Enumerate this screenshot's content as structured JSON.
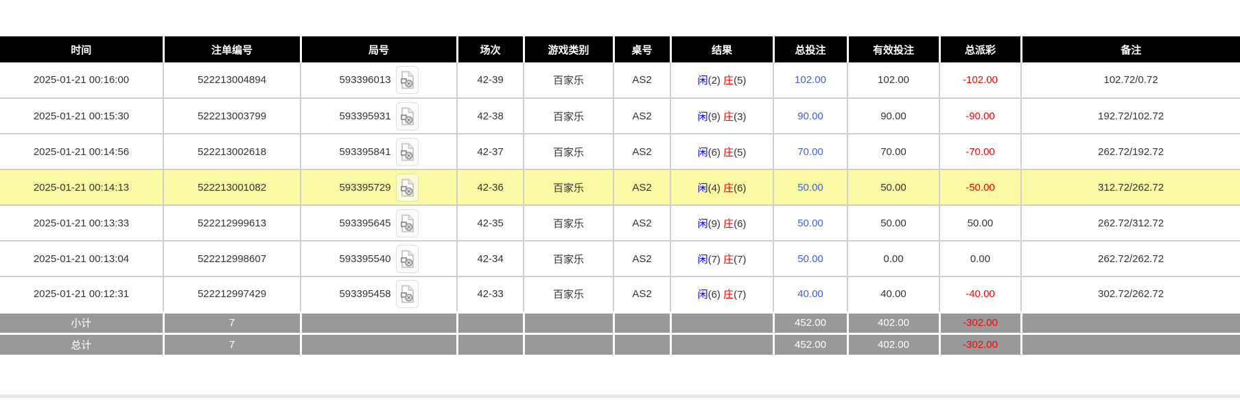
{
  "colors": {
    "header_bg": "#000000",
    "header_text": "#ffffff",
    "row_highlight": "#fafaa5",
    "footer_bg": "#999999",
    "player_blue": "#0000fe",
    "banker_red": "#fe0000",
    "amount_blue": "#3f63d2",
    "negative_red": "#ff0000"
  },
  "icons": {
    "round_replay": "video-file-icon"
  },
  "table": {
    "columns": [
      {
        "key": "time",
        "label": "时间"
      },
      {
        "key": "bet-id",
        "label": "注单编号"
      },
      {
        "key": "round-id",
        "label": "局号"
      },
      {
        "key": "session",
        "label": "场次"
      },
      {
        "key": "game-type",
        "label": "游戏类别"
      },
      {
        "key": "table-no",
        "label": "桌号"
      },
      {
        "key": "result",
        "label": "结果"
      },
      {
        "key": "total-bet",
        "label": "总投注"
      },
      {
        "key": "valid-bet",
        "label": "有效投注"
      },
      {
        "key": "payout",
        "label": "总派彩"
      },
      {
        "key": "remark",
        "label": "备注"
      }
    ],
    "rows": [
      {
        "time": "2025-01-21 00:16:00",
        "bet_id": "522213004894",
        "round_id": "593396013",
        "session": "42-39",
        "game_type": "百家乐",
        "table_no": "AS2",
        "result": {
          "player": "闲",
          "player_score": "(2)",
          "banker": "庄",
          "banker_score": "(5)"
        },
        "total_bet": "102.00",
        "valid_bet": "102.00",
        "payout": "-102.00",
        "remark": "102.72/0.72",
        "highlighted": false
      },
      {
        "time": "2025-01-21 00:15:30",
        "bet_id": "522213003799",
        "round_id": "593395931",
        "session": "42-38",
        "game_type": "百家乐",
        "table_no": "AS2",
        "result": {
          "player": "闲",
          "player_score": "(9)",
          "banker": "庄",
          "banker_score": "(3)"
        },
        "total_bet": "90.00",
        "valid_bet": "90.00",
        "payout": "-90.00",
        "remark": "192.72/102.72",
        "highlighted": false
      },
      {
        "time": "2025-01-21 00:14:56",
        "bet_id": "522213002618",
        "round_id": "593395841",
        "session": "42-37",
        "game_type": "百家乐",
        "table_no": "AS2",
        "result": {
          "player": "闲",
          "player_score": "(6)",
          "banker": "庄",
          "banker_score": "(5)"
        },
        "total_bet": "70.00",
        "valid_bet": "70.00",
        "payout": "-70.00",
        "remark": "262.72/192.72",
        "highlighted": false
      },
      {
        "time": "2025-01-21 00:14:13",
        "bet_id": "522213001082",
        "round_id": "593395729",
        "session": "42-36",
        "game_type": "百家乐",
        "table_no": "AS2",
        "result": {
          "player": "闲",
          "player_score": "(4)",
          "banker": "庄",
          "banker_score": "(6)"
        },
        "total_bet": "50.00",
        "valid_bet": "50.00",
        "payout": "-50.00",
        "remark": "312.72/262.72",
        "highlighted": true
      },
      {
        "time": "2025-01-21 00:13:33",
        "bet_id": "522212999613",
        "round_id": "593395645",
        "session": "42-35",
        "game_type": "百家乐",
        "table_no": "AS2",
        "result": {
          "player": "闲",
          "player_score": "(9)",
          "banker": "庄",
          "banker_score": "(6)"
        },
        "total_bet": "50.00",
        "valid_bet": "50.00",
        "payout": "50.00",
        "remark": "262.72/312.72",
        "highlighted": false
      },
      {
        "time": "2025-01-21 00:13:04",
        "bet_id": "522212998607",
        "round_id": "593395540",
        "session": "42-34",
        "game_type": "百家乐",
        "table_no": "AS2",
        "result": {
          "player": "闲",
          "player_score": "(7)",
          "banker": "庄",
          "banker_score": "(7)"
        },
        "total_bet": "50.00",
        "valid_bet": "0.00",
        "payout": "0.00",
        "remark": "262.72/262.72",
        "highlighted": false
      },
      {
        "time": "2025-01-21 00:12:31",
        "bet_id": "522212997429",
        "round_id": "593395458",
        "session": "42-33",
        "game_type": "百家乐",
        "table_no": "AS2",
        "result": {
          "player": "闲",
          "player_score": "(6)",
          "banker": "庄",
          "banker_score": "(7)"
        },
        "total_bet": "40.00",
        "valid_bet": "40.00",
        "payout": "-40.00",
        "remark": "302.72/262.72",
        "highlighted": false
      }
    ],
    "footer": [
      {
        "name": "subtotal",
        "label": "小计",
        "count": "7",
        "total_bet": "452.00",
        "valid_bet": "402.00",
        "payout": "-302.00"
      },
      {
        "name": "grandtotal",
        "label": "总计",
        "count": "7",
        "total_bet": "452.00",
        "valid_bet": "402.00",
        "payout": "-302.00"
      }
    ]
  }
}
